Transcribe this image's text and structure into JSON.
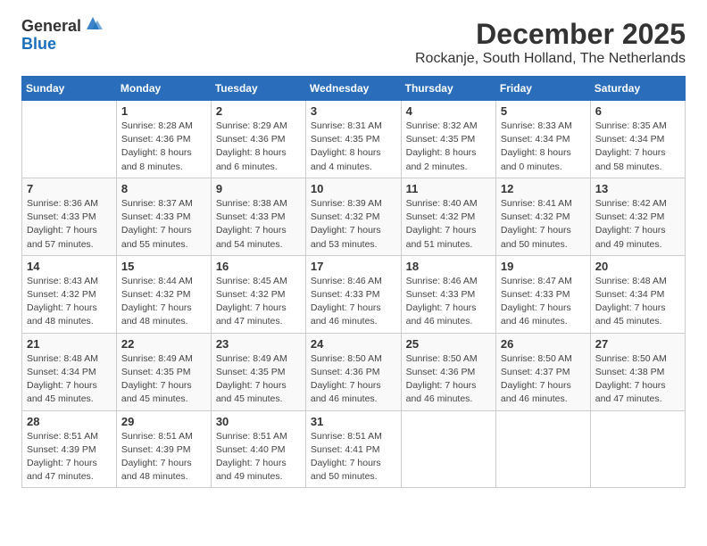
{
  "logo": {
    "general": "General",
    "blue": "Blue"
  },
  "header": {
    "month": "December 2025",
    "location": "Rockanje, South Holland, The Netherlands"
  },
  "weekdays": [
    "Sunday",
    "Monday",
    "Tuesday",
    "Wednesday",
    "Thursday",
    "Friday",
    "Saturday"
  ],
  "weeks": [
    [
      {
        "day": "",
        "info": ""
      },
      {
        "day": "1",
        "info": "Sunrise: 8:28 AM\nSunset: 4:36 PM\nDaylight: 8 hours\nand 8 minutes."
      },
      {
        "day": "2",
        "info": "Sunrise: 8:29 AM\nSunset: 4:36 PM\nDaylight: 8 hours\nand 6 minutes."
      },
      {
        "day": "3",
        "info": "Sunrise: 8:31 AM\nSunset: 4:35 PM\nDaylight: 8 hours\nand 4 minutes."
      },
      {
        "day": "4",
        "info": "Sunrise: 8:32 AM\nSunset: 4:35 PM\nDaylight: 8 hours\nand 2 minutes."
      },
      {
        "day": "5",
        "info": "Sunrise: 8:33 AM\nSunset: 4:34 PM\nDaylight: 8 hours\nand 0 minutes."
      },
      {
        "day": "6",
        "info": "Sunrise: 8:35 AM\nSunset: 4:34 PM\nDaylight: 7 hours\nand 58 minutes."
      }
    ],
    [
      {
        "day": "7",
        "info": "Sunrise: 8:36 AM\nSunset: 4:33 PM\nDaylight: 7 hours\nand 57 minutes."
      },
      {
        "day": "8",
        "info": "Sunrise: 8:37 AM\nSunset: 4:33 PM\nDaylight: 7 hours\nand 55 minutes."
      },
      {
        "day": "9",
        "info": "Sunrise: 8:38 AM\nSunset: 4:33 PM\nDaylight: 7 hours\nand 54 minutes."
      },
      {
        "day": "10",
        "info": "Sunrise: 8:39 AM\nSunset: 4:32 PM\nDaylight: 7 hours\nand 53 minutes."
      },
      {
        "day": "11",
        "info": "Sunrise: 8:40 AM\nSunset: 4:32 PM\nDaylight: 7 hours\nand 51 minutes."
      },
      {
        "day": "12",
        "info": "Sunrise: 8:41 AM\nSunset: 4:32 PM\nDaylight: 7 hours\nand 50 minutes."
      },
      {
        "day": "13",
        "info": "Sunrise: 8:42 AM\nSunset: 4:32 PM\nDaylight: 7 hours\nand 49 minutes."
      }
    ],
    [
      {
        "day": "14",
        "info": "Sunrise: 8:43 AM\nSunset: 4:32 PM\nDaylight: 7 hours\nand 48 minutes."
      },
      {
        "day": "15",
        "info": "Sunrise: 8:44 AM\nSunset: 4:32 PM\nDaylight: 7 hours\nand 48 minutes."
      },
      {
        "day": "16",
        "info": "Sunrise: 8:45 AM\nSunset: 4:32 PM\nDaylight: 7 hours\nand 47 minutes."
      },
      {
        "day": "17",
        "info": "Sunrise: 8:46 AM\nSunset: 4:33 PM\nDaylight: 7 hours\nand 46 minutes."
      },
      {
        "day": "18",
        "info": "Sunrise: 8:46 AM\nSunset: 4:33 PM\nDaylight: 7 hours\nand 46 minutes."
      },
      {
        "day": "19",
        "info": "Sunrise: 8:47 AM\nSunset: 4:33 PM\nDaylight: 7 hours\nand 46 minutes."
      },
      {
        "day": "20",
        "info": "Sunrise: 8:48 AM\nSunset: 4:34 PM\nDaylight: 7 hours\nand 45 minutes."
      }
    ],
    [
      {
        "day": "21",
        "info": "Sunrise: 8:48 AM\nSunset: 4:34 PM\nDaylight: 7 hours\nand 45 minutes."
      },
      {
        "day": "22",
        "info": "Sunrise: 8:49 AM\nSunset: 4:35 PM\nDaylight: 7 hours\nand 45 minutes."
      },
      {
        "day": "23",
        "info": "Sunrise: 8:49 AM\nSunset: 4:35 PM\nDaylight: 7 hours\nand 45 minutes."
      },
      {
        "day": "24",
        "info": "Sunrise: 8:50 AM\nSunset: 4:36 PM\nDaylight: 7 hours\nand 46 minutes."
      },
      {
        "day": "25",
        "info": "Sunrise: 8:50 AM\nSunset: 4:36 PM\nDaylight: 7 hours\nand 46 minutes."
      },
      {
        "day": "26",
        "info": "Sunrise: 8:50 AM\nSunset: 4:37 PM\nDaylight: 7 hours\nand 46 minutes."
      },
      {
        "day": "27",
        "info": "Sunrise: 8:50 AM\nSunset: 4:38 PM\nDaylight: 7 hours\nand 47 minutes."
      }
    ],
    [
      {
        "day": "28",
        "info": "Sunrise: 8:51 AM\nSunset: 4:39 PM\nDaylight: 7 hours\nand 47 minutes."
      },
      {
        "day": "29",
        "info": "Sunrise: 8:51 AM\nSunset: 4:39 PM\nDaylight: 7 hours\nand 48 minutes."
      },
      {
        "day": "30",
        "info": "Sunrise: 8:51 AM\nSunset: 4:40 PM\nDaylight: 7 hours\nand 49 minutes."
      },
      {
        "day": "31",
        "info": "Sunrise: 8:51 AM\nSunset: 4:41 PM\nDaylight: 7 hours\nand 50 minutes."
      },
      {
        "day": "",
        "info": ""
      },
      {
        "day": "",
        "info": ""
      },
      {
        "day": "",
        "info": ""
      }
    ]
  ]
}
